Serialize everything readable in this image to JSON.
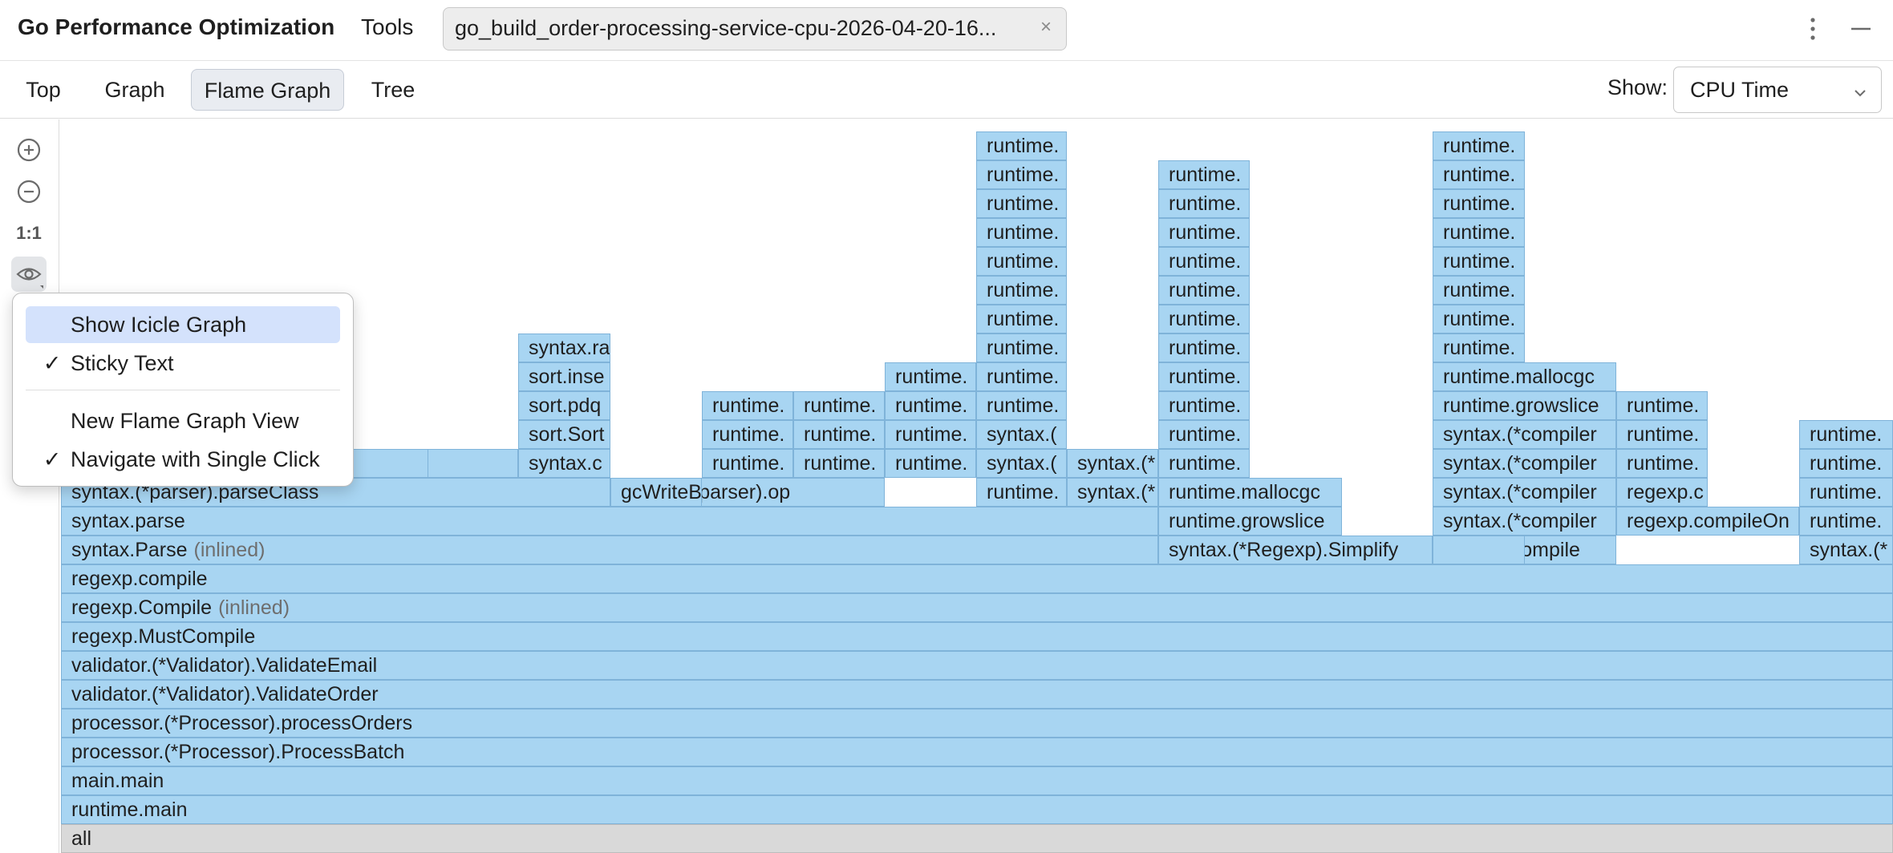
{
  "header": {
    "app_title": "Go Performance Optimization",
    "tools_label": "Tools",
    "file_tab": "go_build_order-processing-service-cpu-2026-04-20-16...",
    "close_glyph": "×",
    "more_icon": "more-vertical-icon",
    "minimize_icon": "minimize-icon"
  },
  "view_tabs": [
    {
      "label": "Top",
      "active": false
    },
    {
      "label": "Graph",
      "active": false
    },
    {
      "label": "Flame Graph",
      "active": true
    },
    {
      "label": "Tree",
      "active": false
    }
  ],
  "show": {
    "label": "Show:",
    "value": "CPU Time"
  },
  "side_toolbar": {
    "zoom_in_icon": "zoom-in-icon",
    "zoom_out_icon": "zoom-out-icon",
    "actual_size_label": "1:1",
    "view_options_icon": "eye-icon"
  },
  "popup_menu": {
    "items": [
      {
        "label": "Show Icicle Graph",
        "checked": false,
        "selected": true
      },
      {
        "label": "Sticky Text",
        "checked": true,
        "selected": false
      },
      {
        "label": "New Flame Graph View",
        "checked": false,
        "selected": false
      },
      {
        "label": "Navigate with Single Click",
        "checked": true,
        "selected": false
      }
    ],
    "check_glyph": "✓"
  },
  "flame_graph": {
    "frame_color": "#a8d5f2",
    "root_color": "#d9d9d9",
    "frames": [
      {
        "name": "all",
        "root": true
      },
      {
        "name": "runtime.main"
      },
      {
        "name": "main.main"
      },
      {
        "name": "processor.(*Processor).ProcessBatch"
      },
      {
        "name": "processor.(*Processor).processOrders"
      },
      {
        "name": "validator.(*Validator).ValidateOrder"
      },
      {
        "name": "validator.(*Validator).ValidateEmail"
      },
      {
        "name": "regexp.MustCompile"
      },
      {
        "name": "regexp.Compile",
        "note": "(inlined)"
      },
      {
        "name": "regexp.compile"
      },
      {
        "name": "syntax.Parse",
        "note": "(inlined)"
      },
      {
        "name": "syntax.parse"
      },
      {
        "name": "syntax.(*parser).parseClass"
      },
      {
        "name": ""
      },
      {
        "name": ""
      },
      {
        "name": "syntax.c"
      },
      {
        "name": "sort.Sort"
      },
      {
        "name": "sort.pdq"
      },
      {
        "name": "sort.inse"
      },
      {
        "name": "syntax.ra"
      },
      {
        "name": "syntax.(*parser).op"
      },
      {
        "name": "gcWriteB"
      },
      {
        "name": "syntax.(*parser).p"
      },
      {
        "name": "runtime."
      },
      {
        "name": "runtime."
      },
      {
        "name": "runtime."
      },
      {
        "name": "syntax.(*"
      },
      {
        "name": "runtime."
      },
      {
        "name": "runtime."
      },
      {
        "name": "runtime."
      },
      {
        "name": "runtime."
      },
      {
        "name": "runtime."
      },
      {
        "name": "runtime."
      },
      {
        "name": "runtime."
      },
      {
        "name": "runtime."
      },
      {
        "name": "syntax.("
      },
      {
        "name": "syntax.("
      },
      {
        "name": "runtime."
      },
      {
        "name": "runtime."
      },
      {
        "name": "runtime."
      },
      {
        "name": "runtime."
      },
      {
        "name": "runtime."
      },
      {
        "name": "runtime."
      },
      {
        "name": "runtime."
      },
      {
        "name": "runtime."
      },
      {
        "name": "runtime."
      },
      {
        "name": "runtime."
      },
      {
        "name": ""
      },
      {
        "name": "syntax.(*"
      },
      {
        "name": "syntax.(*"
      },
      {
        "name": "syntax.(*Regexp).Simplify"
      },
      {
        "name": "runtime.growslice"
      },
      {
        "name": "runtime.mallocgc"
      },
      {
        "name": "runtime."
      },
      {
        "name": "runtime."
      },
      {
        "name": "runtime."
      },
      {
        "name": "runtime."
      },
      {
        "name": "runtime."
      },
      {
        "name": "runtime."
      },
      {
        "name": "runtime."
      },
      {
        "name": "runtime."
      },
      {
        "name": "runtime."
      },
      {
        "name": "runtime."
      },
      {
        "name": "runtime."
      },
      {
        "name": "syntax.Compile"
      },
      {
        "name": "syntax.(*compiler"
      },
      {
        "name": "syntax.(*compiler"
      },
      {
        "name": "syntax.(*compiler"
      },
      {
        "name": "syntax.(*compiler"
      },
      {
        "name": "runtime.growslice"
      },
      {
        "name": "runtime.mallocgc"
      },
      {
        "name": "runtime."
      },
      {
        "name": "runtime."
      },
      {
        "name": "runtime."
      },
      {
        "name": "runtime."
      },
      {
        "name": "runtime."
      },
      {
        "name": "runtime."
      },
      {
        "name": "runtime."
      },
      {
        "name": "runtime."
      },
      {
        "name": ""
      },
      {
        "name": "regexp.compileOn"
      },
      {
        "name": "regexp.c"
      },
      {
        "name": "runtime."
      },
      {
        "name": "runtime."
      },
      {
        "name": "runtime."
      },
      {
        "name": "syntax.(*"
      },
      {
        "name": "runtime."
      },
      {
        "name": "runtime."
      },
      {
        "name": "runtime."
      },
      {
        "name": "runtime."
      }
    ]
  }
}
